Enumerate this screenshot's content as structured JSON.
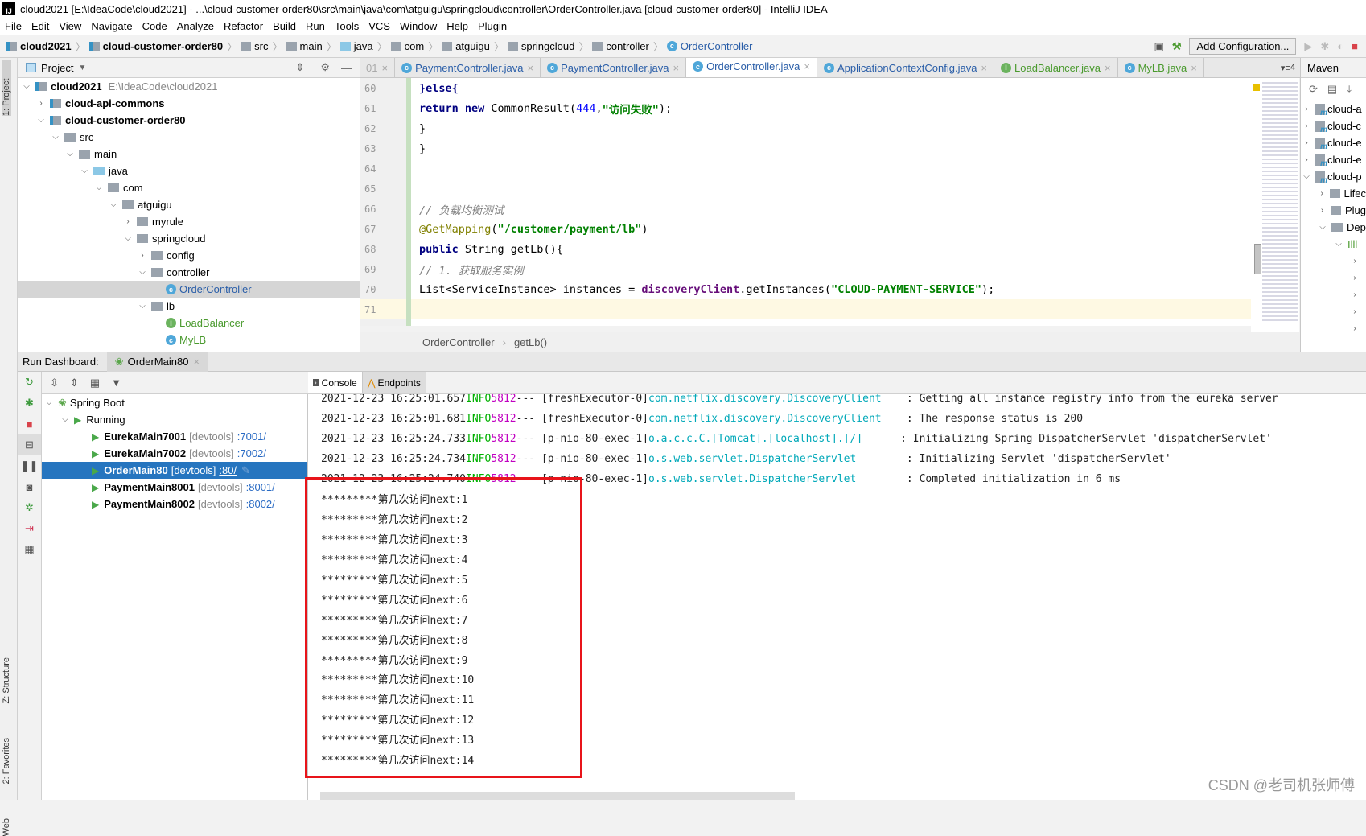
{
  "window": {
    "title": "cloud2021 [E:\\IdeaCode\\cloud2021] - ...\\cloud-customer-order80\\src\\main\\java\\com\\atguigu\\springcloud\\controller\\OrderController.java [cloud-customer-order80] - IntelliJ IDEA"
  },
  "menu": [
    "File",
    "Edit",
    "View",
    "Navigate",
    "Code",
    "Analyze",
    "Refactor",
    "Build",
    "Run",
    "Tools",
    "VCS",
    "Window",
    "Help",
    "Plugin"
  ],
  "breadcrumb": [
    "cloud2021",
    "cloud-customer-order80",
    "src",
    "main",
    "java",
    "com",
    "atguigu",
    "springcloud",
    "controller",
    "OrderController"
  ],
  "toolbar": {
    "add_configuration": "Add Configuration..."
  },
  "side_tabs": {
    "project": "1: Project",
    "structure": "Z: Structure",
    "favorites": "2: Favorites",
    "web": "Web"
  },
  "project": {
    "title": "Project",
    "tree": [
      {
        "label": "cloud2021",
        "hint": "E:\\IdeaCode\\cloud2021"
      },
      {
        "label": "cloud-api-commons"
      },
      {
        "label": "cloud-customer-order80"
      },
      {
        "label": "src"
      },
      {
        "label": "main"
      },
      {
        "label": "java"
      },
      {
        "label": "com"
      },
      {
        "label": "atguigu"
      },
      {
        "label": "myrule"
      },
      {
        "label": "springcloud"
      },
      {
        "label": "config"
      },
      {
        "label": "controller"
      },
      {
        "label": "OrderController"
      },
      {
        "label": "lb"
      },
      {
        "label": "LoadBalancer"
      },
      {
        "label": "MyLB"
      }
    ]
  },
  "editor": {
    "tabs": [
      "01",
      "PaymentController.java",
      "PaymentController.java",
      "OrderController.java",
      "ApplicationContextConfig.java",
      "LoadBalancer.java",
      "MyLB.java"
    ],
    "tab_count": "4",
    "line_numbers": [
      "60",
      "61",
      "62",
      "63",
      "64",
      "65",
      "66",
      "67",
      "68",
      "69",
      "70",
      "71"
    ],
    "code": {
      "l60": "}else{",
      "l61_kw": "return new ",
      "l61_cls": "CommonResult(",
      "l61_num": "444",
      "l61_str": "\"访问失败\"",
      "l61_end": ");",
      "l62": "}",
      "l63": "}",
      "l66": "// 负载均衡测试",
      "l67_ann": "@GetMapping",
      "l67_str": "\"/customer/payment/lb\"",
      "l68_kw": "public ",
      "l68_rest": "String getLb(){",
      "l69": "// 1. 获取服务实例",
      "l70_a": "List<ServiceInstance> instances = ",
      "l70_fld": "discoveryClient",
      "l70_b": ".getInstances(",
      "l70_str": "\"CLOUD-PAYMENT-SERVICE\"",
      "l70_end": ");"
    },
    "crumbs": [
      "OrderController",
      "getLb()"
    ]
  },
  "maven": {
    "title": "Maven",
    "items": [
      "cloud-a",
      "cloud-c",
      "cloud-e",
      "cloud-e",
      "cloud-p",
      "Lifec",
      "Plug",
      "Dep"
    ]
  },
  "run": {
    "label": "Run Dashboard:",
    "tab": "OrderMain80",
    "tree": {
      "root": "Spring Boot",
      "group": "Running",
      "apps": [
        {
          "name": "EurekaMain7001",
          "tag": "[devtools]",
          "port": ":7001/"
        },
        {
          "name": "EurekaMain7002",
          "tag": "[devtools]",
          "port": ":7002/"
        },
        {
          "name": "OrderMain80",
          "tag": "[devtools]",
          "port": ":80/"
        },
        {
          "name": "PaymentMain8001",
          "tag": "[devtools]",
          "port": ":8001/"
        },
        {
          "name": "PaymentMain8002",
          "tag": "[devtools]",
          "port": ":8002/"
        }
      ]
    },
    "console_tabs": [
      "Console",
      "Endpoints"
    ],
    "log": [
      {
        "ts": "2021-12-23 16:25:01.657",
        "lvl": "INFO",
        "pid": "5812",
        "thread": "--- [freshExecutor-0]",
        "logger": "com.netflix.discovery.DiscoveryClient    ",
        "msg": ": Getting all instance registry info from the eureka server"
      },
      {
        "ts": "2021-12-23 16:25:01.681",
        "lvl": "INFO",
        "pid": "5812",
        "thread": "--- [freshExecutor-0]",
        "logger": "com.netflix.discovery.DiscoveryClient    ",
        "msg": ": The response status is 200"
      },
      {
        "ts": "2021-12-23 16:25:24.733",
        "lvl": "INFO",
        "pid": "5812",
        "thread": "--- [p-nio-80-exec-1]",
        "logger": "o.a.c.c.C.[Tomcat].[localhost].[/]      ",
        "msg": ": Initializing Spring DispatcherServlet 'dispatcherServlet'"
      },
      {
        "ts": "2021-12-23 16:25:24.734",
        "lvl": "INFO",
        "pid": "5812",
        "thread": "--- [p-nio-80-exec-1]",
        "logger": "o.s.web.servlet.DispatcherServlet        ",
        "msg": ": Initializing Servlet 'dispatcherServlet'"
      },
      {
        "ts": "2021-12-23 16:25:24.740",
        "lvl": "INFO",
        "pid": "5812",
        "thread": "--- [p-nio-80-exec-1]",
        "logger": "o.s.web.servlet.DispatcherServlet        ",
        "msg": ": Completed initialization in 6 ms"
      }
    ],
    "output": [
      "*********第几次访问next:1",
      "*********第几次访问next:2",
      "*********第几次访问next:3",
      "*********第几次访问next:4",
      "*********第几次访问next:5",
      "*********第几次访问next:6",
      "*********第几次访问next:7",
      "*********第几次访问next:8",
      "*********第几次访问next:9",
      "*********第几次访问next:10",
      "*********第几次访问next:11",
      "*********第几次访问next:12",
      "*********第几次访问next:13",
      "*********第几次访问next:14"
    ]
  },
  "watermark": "CSDN @老司机张师傅",
  "colors": {
    "highlight_box": "#e8141a",
    "selection": "#2675bf",
    "string": "#008000",
    "keyword": "#000080"
  }
}
